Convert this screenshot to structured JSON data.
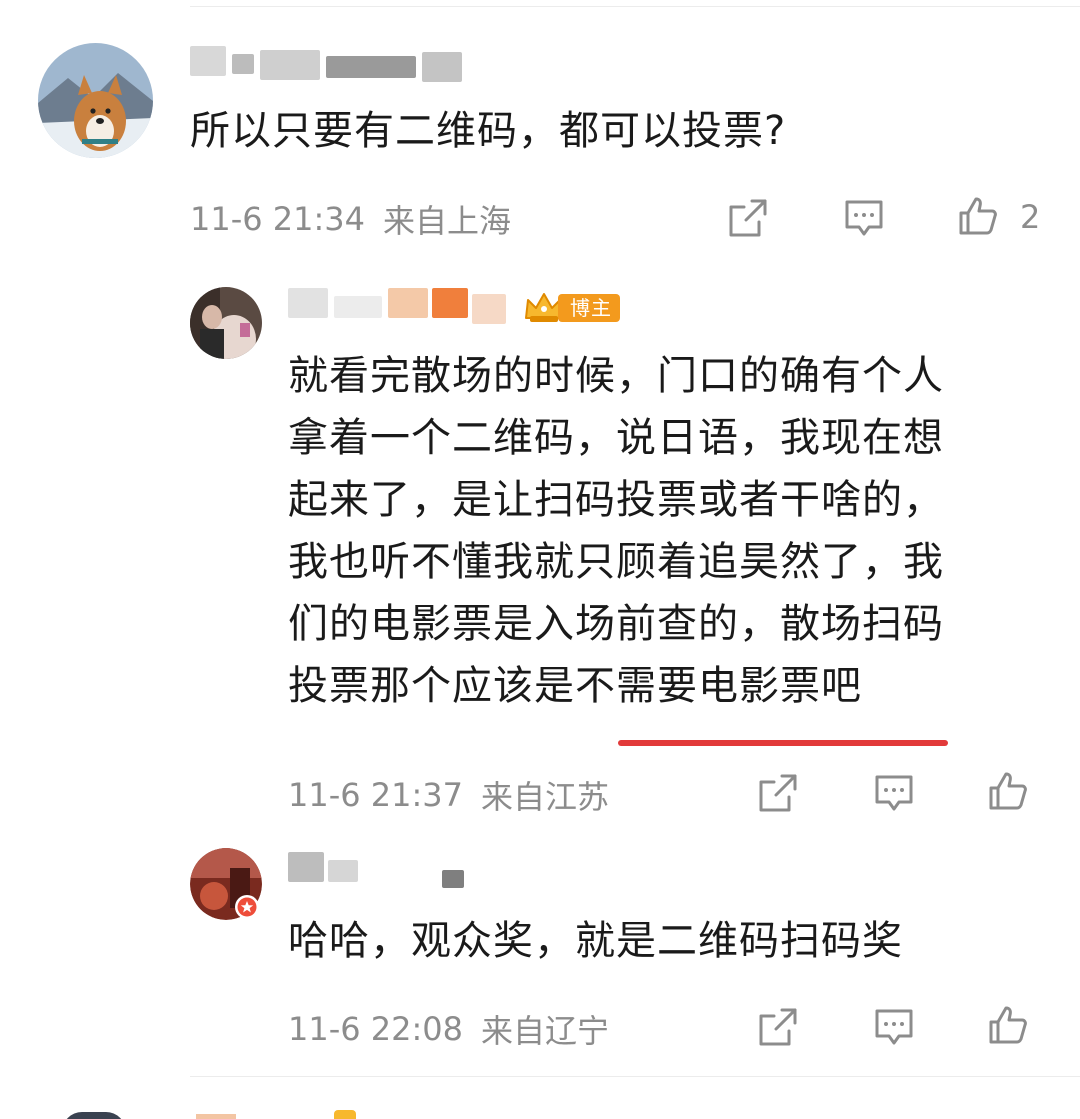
{
  "comments": [
    {
      "text": "所以只要有二维码，都可以投票?",
      "time": "11-6 21:34",
      "location": "来自上海",
      "likes": "2"
    },
    {
      "badge": "博主",
      "text": "就看完散场的时候，门口的确有个人\n拿着一个二维码，说日语，我现在想\n起来了，是让扫码投票或者干啥的，\n我也听不懂我就只顾着追昊然了，我\n们的电影票是入场前查的，散场扫码\n投票那个应该是不需要电影票吧",
      "time": "11-6 21:37",
      "location": "来自江苏"
    },
    {
      "text": "哈哈，观众奖，就是二维码扫码奖",
      "time": "11-6 22:08",
      "location": "来自辽宁"
    }
  ],
  "icons": {
    "share": "share-icon",
    "comment": "comment-icon",
    "like": "thumbs-up-icon",
    "verified": "verified-badge-icon",
    "crown": "crown-badge-icon"
  },
  "colors": {
    "text": "#1a1a1a",
    "meta": "#8c8c8c",
    "badge": "#f39a1d",
    "underline": "#e23a3a"
  }
}
